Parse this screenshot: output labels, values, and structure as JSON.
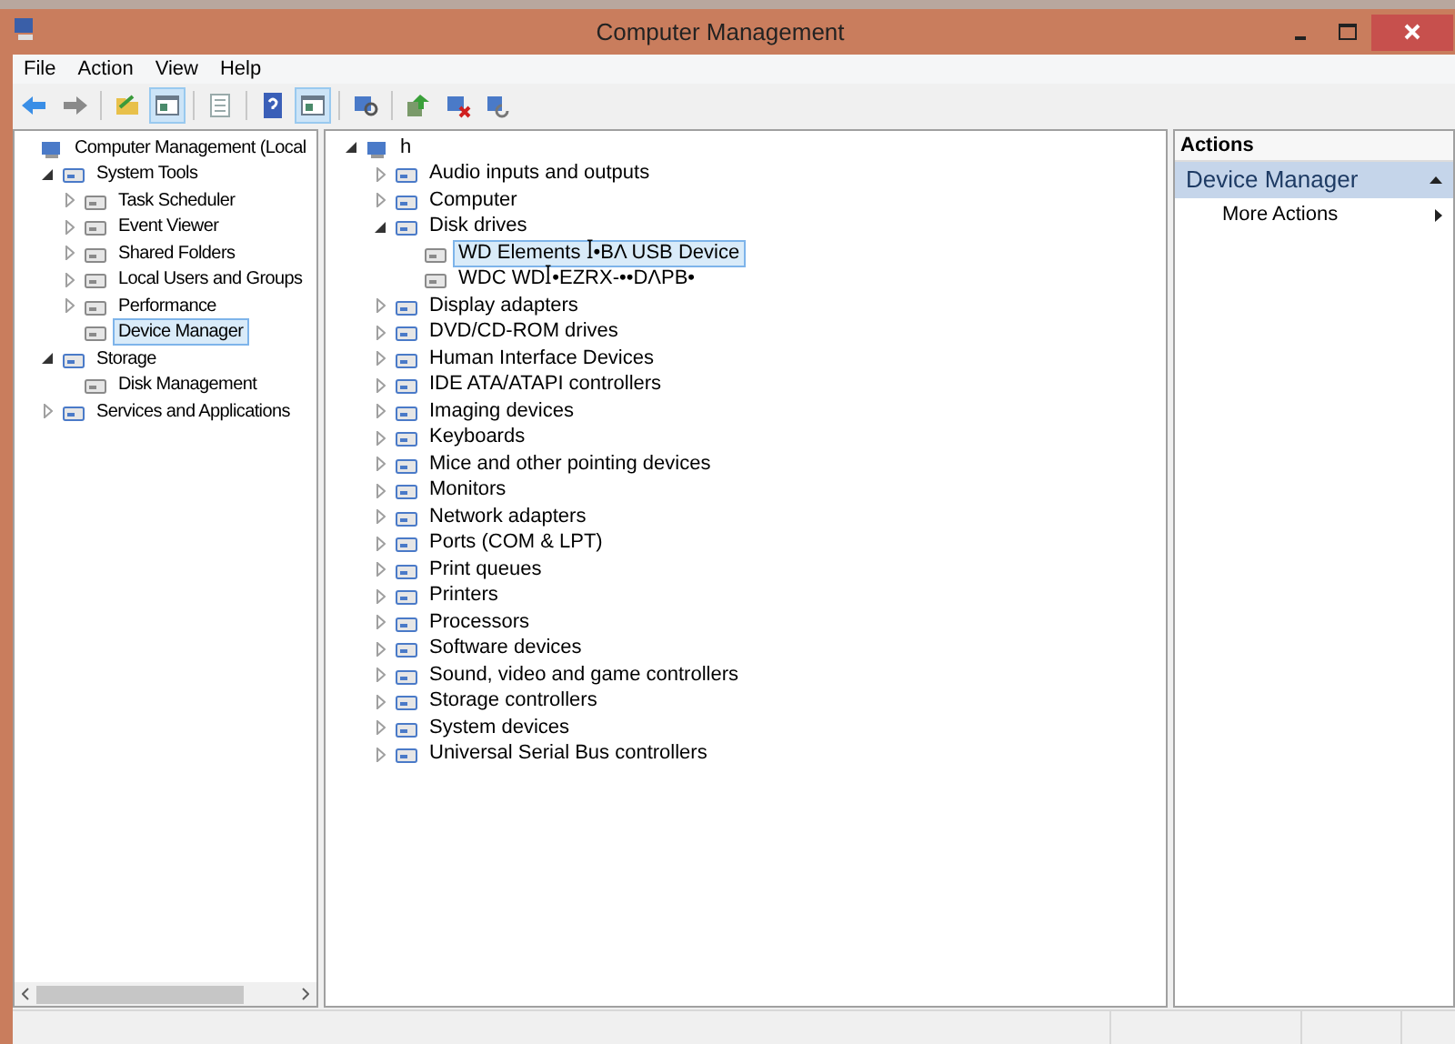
{
  "window": {
    "title": "Computer Management"
  },
  "menu": [
    "File",
    "Action",
    "View",
    "Help"
  ],
  "toolbar": [
    {
      "kind": "back",
      "pressed": false
    },
    {
      "kind": "forward",
      "pressed": false
    },
    {
      "kind": "sep"
    },
    {
      "kind": "folder",
      "pressed": false
    },
    {
      "kind": "pane",
      "pressed": true
    },
    {
      "kind": "sep"
    },
    {
      "kind": "sheet",
      "pressed": false
    },
    {
      "kind": "sep"
    },
    {
      "kind": "help",
      "pressed": false
    },
    {
      "kind": "pane",
      "pressed": true
    },
    {
      "kind": "sep"
    },
    {
      "kind": "scan",
      "pressed": false
    },
    {
      "kind": "sep"
    },
    {
      "kind": "update",
      "pressed": false
    },
    {
      "kind": "remove",
      "pressed": false
    },
    {
      "kind": "refresh",
      "pressed": false
    }
  ],
  "navigation_tree": [
    {
      "label": "Computer Management (Local",
      "selected": false,
      "children": [
        {
          "label": "System Tools",
          "expanded": true,
          "selected": false,
          "children": [
            {
              "label": "Task Scheduler",
              "expanded": false,
              "selected": false
            },
            {
              "label": "Event Viewer",
              "expanded": false,
              "selected": false
            },
            {
              "label": "Shared Folders",
              "expanded": false,
              "selected": false
            },
            {
              "label": "Local Users and Groups",
              "expanded": false,
              "selected": false
            },
            {
              "label": "Performance",
              "expanded": false,
              "selected": false
            },
            {
              "label": "Device Manager",
              "selected": true
            }
          ]
        },
        {
          "label": "Storage",
          "expanded": true,
          "selected": false,
          "children": [
            {
              "label": "Disk Management",
              "selected": false
            }
          ]
        },
        {
          "label": "Services and Applications",
          "expanded": false,
          "selected": false
        }
      ]
    }
  ],
  "device_tree": [
    {
      "label": "h",
      "expanded": true,
      "selected": false,
      "children": [
        {
          "label": "Audio inputs and outputs",
          "expanded": false,
          "selected": false
        },
        {
          "label": "Computer",
          "expanded": false,
          "selected": false
        },
        {
          "label": "Disk drives",
          "expanded": true,
          "selected": false,
          "children": [
            {
              "label": "WD Elements ꟾ•BΛ USB Device",
              "selected": true
            },
            {
              "label": "WDC WDꟾ•EZRX-••DΛPB•",
              "selected": false
            }
          ]
        },
        {
          "label": "Display adapters",
          "expanded": false,
          "selected": false
        },
        {
          "label": "DVD/CD-ROM drives",
          "expanded": false,
          "selected": false
        },
        {
          "label": "Human Interface Devices",
          "expanded": false,
          "selected": false
        },
        {
          "label": "IDE ATA/ATAPI controllers",
          "expanded": false,
          "selected": false
        },
        {
          "label": "Imaging devices",
          "expanded": false,
          "selected": false
        },
        {
          "label": "Keyboards",
          "expanded": false,
          "selected": false
        },
        {
          "label": "Mice and other pointing devices",
          "expanded": false,
          "selected": false
        },
        {
          "label": "Monitors",
          "expanded": false,
          "selected": false
        },
        {
          "label": "Network adapters",
          "expanded": false,
          "selected": false
        },
        {
          "label": "Ports (COM & LPT)",
          "expanded": false,
          "selected": false
        },
        {
          "label": "Print queues",
          "expanded": false,
          "selected": false
        },
        {
          "label": "Printers",
          "expanded": false,
          "selected": false
        },
        {
          "label": "Processors",
          "expanded": false,
          "selected": false
        },
        {
          "label": "Software devices",
          "expanded": false,
          "selected": false
        },
        {
          "label": "Sound, video and game controllers",
          "expanded": false,
          "selected": false
        },
        {
          "label": "Storage controllers",
          "expanded": false,
          "selected": false
        },
        {
          "label": "System devices",
          "expanded": false,
          "selected": false
        },
        {
          "label": "Universal Serial Bus controllers",
          "expanded": false,
          "selected": false
        }
      ]
    }
  ],
  "actions": {
    "header": "Actions",
    "section": {
      "title": "Device Manager",
      "expanded": true
    },
    "items": [
      "More Actions"
    ]
  }
}
